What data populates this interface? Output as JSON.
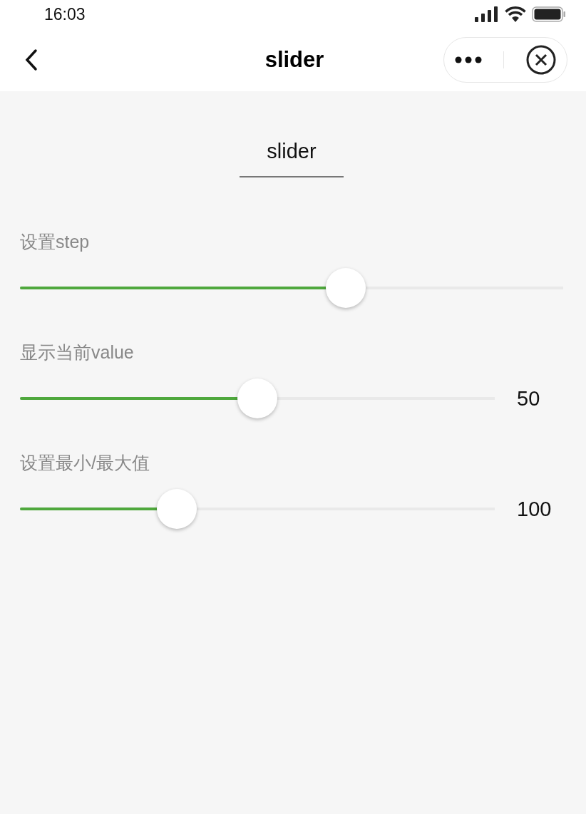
{
  "status_bar": {
    "time": "16:03"
  },
  "nav_bar": {
    "title": "slider"
  },
  "page": {
    "heading": "slider"
  },
  "sliders": [
    {
      "label": "设置step",
      "level": 0.6
    },
    {
      "label": "显示当前value",
      "level": 0.5,
      "reading": "50"
    },
    {
      "label": "设置最小/最大值",
      "level": 0.33,
      "reading": "100"
    }
  ]
}
